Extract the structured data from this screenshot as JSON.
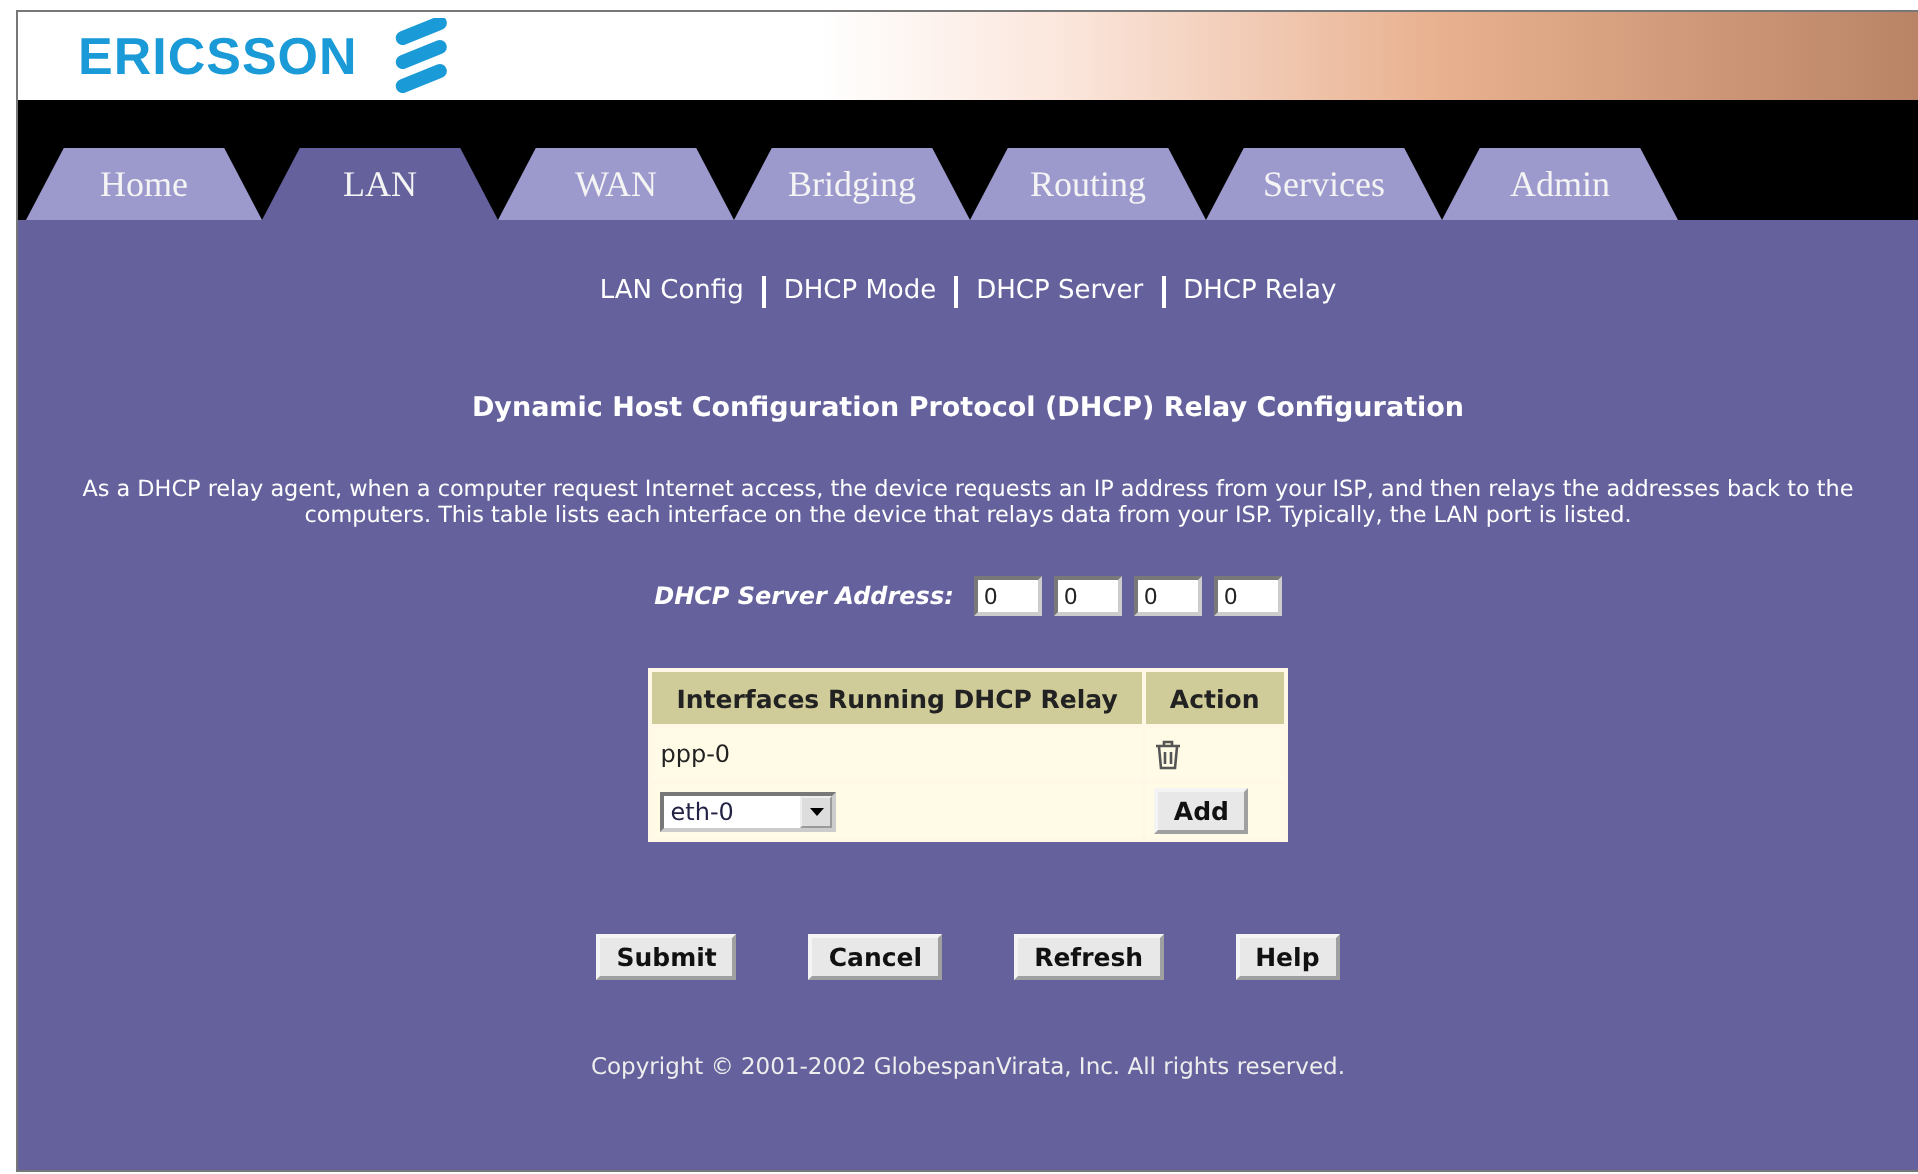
{
  "logo": {
    "text": "ERICSSON"
  },
  "tabs": [
    {
      "label": "Home",
      "selected": false
    },
    {
      "label": "LAN",
      "selected": true
    },
    {
      "label": "WAN",
      "selected": false
    },
    {
      "label": "Bridging",
      "selected": false
    },
    {
      "label": "Routing",
      "selected": false
    },
    {
      "label": "Services",
      "selected": false
    },
    {
      "label": "Admin",
      "selected": false
    }
  ],
  "subnav": [
    {
      "label": "LAN Config"
    },
    {
      "label": "DHCP Mode"
    },
    {
      "label": "DHCP Server"
    },
    {
      "label": "DHCP Relay"
    }
  ],
  "heading": "Dynamic Host Configuration Protocol (DHCP) Relay Configuration",
  "description": "As a DHCP relay agent, when a computer request Internet access, the device requests an IP address from your ISP, and then relays the addresses back to the computers. This table lists each interface on the device that relays data from your ISP. Typically, the LAN port is listed.",
  "server_address": {
    "label": "DHCP Server Address:",
    "octets": [
      "0",
      "0",
      "0",
      "0"
    ]
  },
  "table": {
    "columns": [
      "Interfaces Running DHCP Relay",
      "Action"
    ],
    "rows": [
      {
        "interface": "ppp-0"
      }
    ],
    "add_row": {
      "select_value": "eth-0",
      "button": "Add"
    }
  },
  "buttons": [
    "Submit",
    "Cancel",
    "Refresh",
    "Help"
  ],
  "footer": "Copyright © 2001-2002 GlobespanVirata, Inc. All rights reserved."
}
